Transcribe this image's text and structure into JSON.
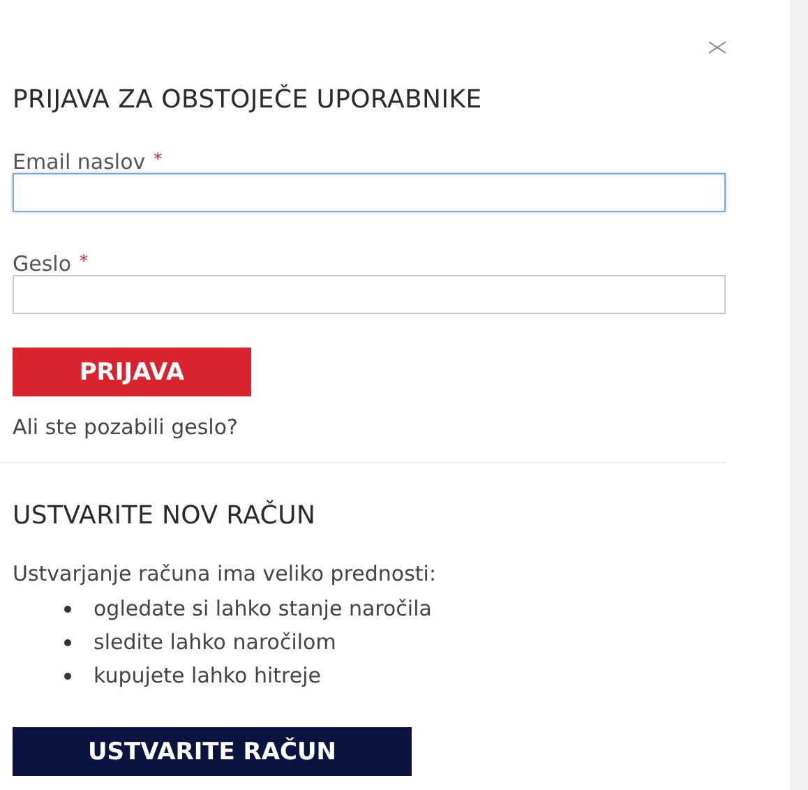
{
  "login": {
    "title": "PRIJAVA ZA OBSTOJEČE UPORABNIKE",
    "fields": [
      {
        "label": "Email naslov",
        "required_mark": "*",
        "focused": true
      },
      {
        "label": "Geslo",
        "required_mark": "*",
        "focused": false
      }
    ],
    "submit": "PRIJAVA",
    "forgot_link": "Ali ste pozabili geslo?"
  },
  "register": {
    "title": "USTVARITE NOV RAČUN",
    "intro": "Ustvarjanje računa ima veliko prednosti:",
    "benefits": [
      "ogledate si lahko stanje naročila",
      "sledite lahko naročilom",
      "kupujete lahko hitreje"
    ],
    "button": "USTVARITE RAČUN"
  }
}
